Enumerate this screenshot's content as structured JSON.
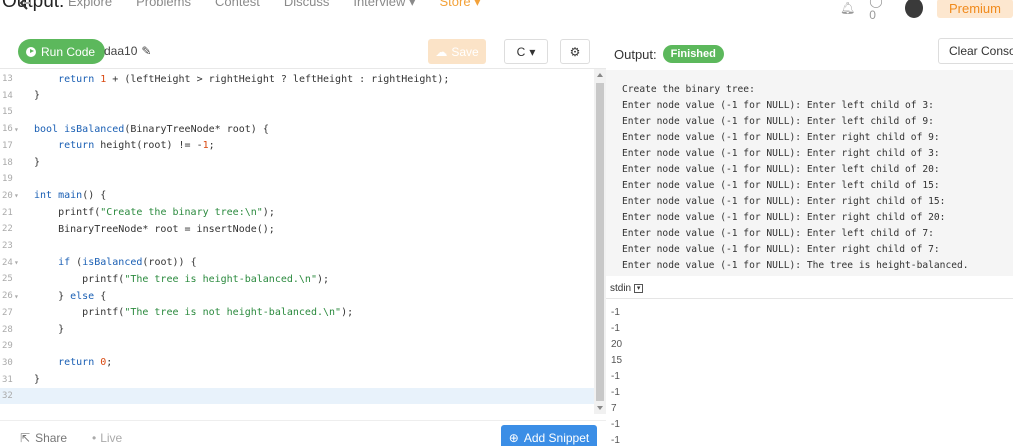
{
  "caption": "Output:",
  "nav": {
    "items": [
      "Explore",
      "Problems",
      "Contest",
      "Discuss",
      "Interview ▾",
      "Store ▾"
    ],
    "notifications": "0",
    "premium": "Premium"
  },
  "toolbar": {
    "run_label": "Run Code",
    "filename": "daa10",
    "save_label": "Save",
    "language": "C"
  },
  "editor": {
    "lines": [
      {
        "n": "13",
        "fold": "",
        "code": "    return 1 + (leftHeight > rightHeight ? leftHeight : rightHeight);"
      },
      {
        "n": "14",
        "fold": "",
        "code": "}"
      },
      {
        "n": "15",
        "fold": "",
        "code": ""
      },
      {
        "n": "16",
        "fold": "▾",
        "code": "bool isBalanced(BinaryTreeNode* root) {"
      },
      {
        "n": "17",
        "fold": "",
        "code": "    return height(root) != -1;"
      },
      {
        "n": "18",
        "fold": "",
        "code": "}"
      },
      {
        "n": "19",
        "fold": "",
        "code": ""
      },
      {
        "n": "20",
        "fold": "▾",
        "code": "int main() {"
      },
      {
        "n": "21",
        "fold": "",
        "code": "    printf(\"Create the binary tree:\\n\");"
      },
      {
        "n": "22",
        "fold": "",
        "code": "    BinaryTreeNode* root = insertNode();"
      },
      {
        "n": "23",
        "fold": "",
        "code": ""
      },
      {
        "n": "24",
        "fold": "▾",
        "code": "    if (isBalanced(root)) {"
      },
      {
        "n": "25",
        "fold": "",
        "code": "        printf(\"The tree is height-balanced.\\n\");"
      },
      {
        "n": "26",
        "fold": "▾",
        "code": "    } else {"
      },
      {
        "n": "27",
        "fold": "",
        "code": "        printf(\"The tree is not height-balanced.\\n\");"
      },
      {
        "n": "28",
        "fold": "",
        "code": "    }"
      },
      {
        "n": "29",
        "fold": "",
        "code": ""
      },
      {
        "n": "30",
        "fold": "",
        "code": "    return 0;"
      },
      {
        "n": "31",
        "fold": "",
        "code": "}"
      },
      {
        "n": "32",
        "fold": "",
        "code": ""
      }
    ]
  },
  "bottom": {
    "share_label": "Share",
    "live_label": "Live",
    "add_snippet_label": "Add Snippet"
  },
  "output": {
    "label": "Output:",
    "status": "Finished",
    "clear_label": "Clear Console",
    "lines": [
      "Create the binary tree:",
      "Enter node value (-1 for NULL): Enter left child of 3:",
      "Enter node value (-1 for NULL): Enter left child of 9:",
      "Enter node value (-1 for NULL): Enter right child of 9:",
      "Enter node value (-1 for NULL): Enter right child of 3:",
      "Enter node value (-1 for NULL): Enter left child of 20:",
      "Enter node value (-1 for NULL): Enter left child of 15:",
      "Enter node value (-1 for NULL): Enter right child of 15:",
      "Enter node value (-1 for NULL): Enter right child of 20:",
      "Enter node value (-1 for NULL): Enter left child of 7:",
      "Enter node value (-1 for NULL): Enter right child of 7:",
      "Enter node value (-1 for NULL): The tree is height-balanced."
    ]
  },
  "stdin": {
    "label": "stdin",
    "lines": [
      "-1",
      "-1",
      "20",
      "15",
      "-1",
      "-1",
      "7",
      "-1",
      "-1"
    ]
  },
  "colors": {
    "run_green": "#5cb85c",
    "save_orange": "#fbe3c7",
    "snippet_blue": "#3b8ee6",
    "console_bg": "#f5f5f5"
  }
}
